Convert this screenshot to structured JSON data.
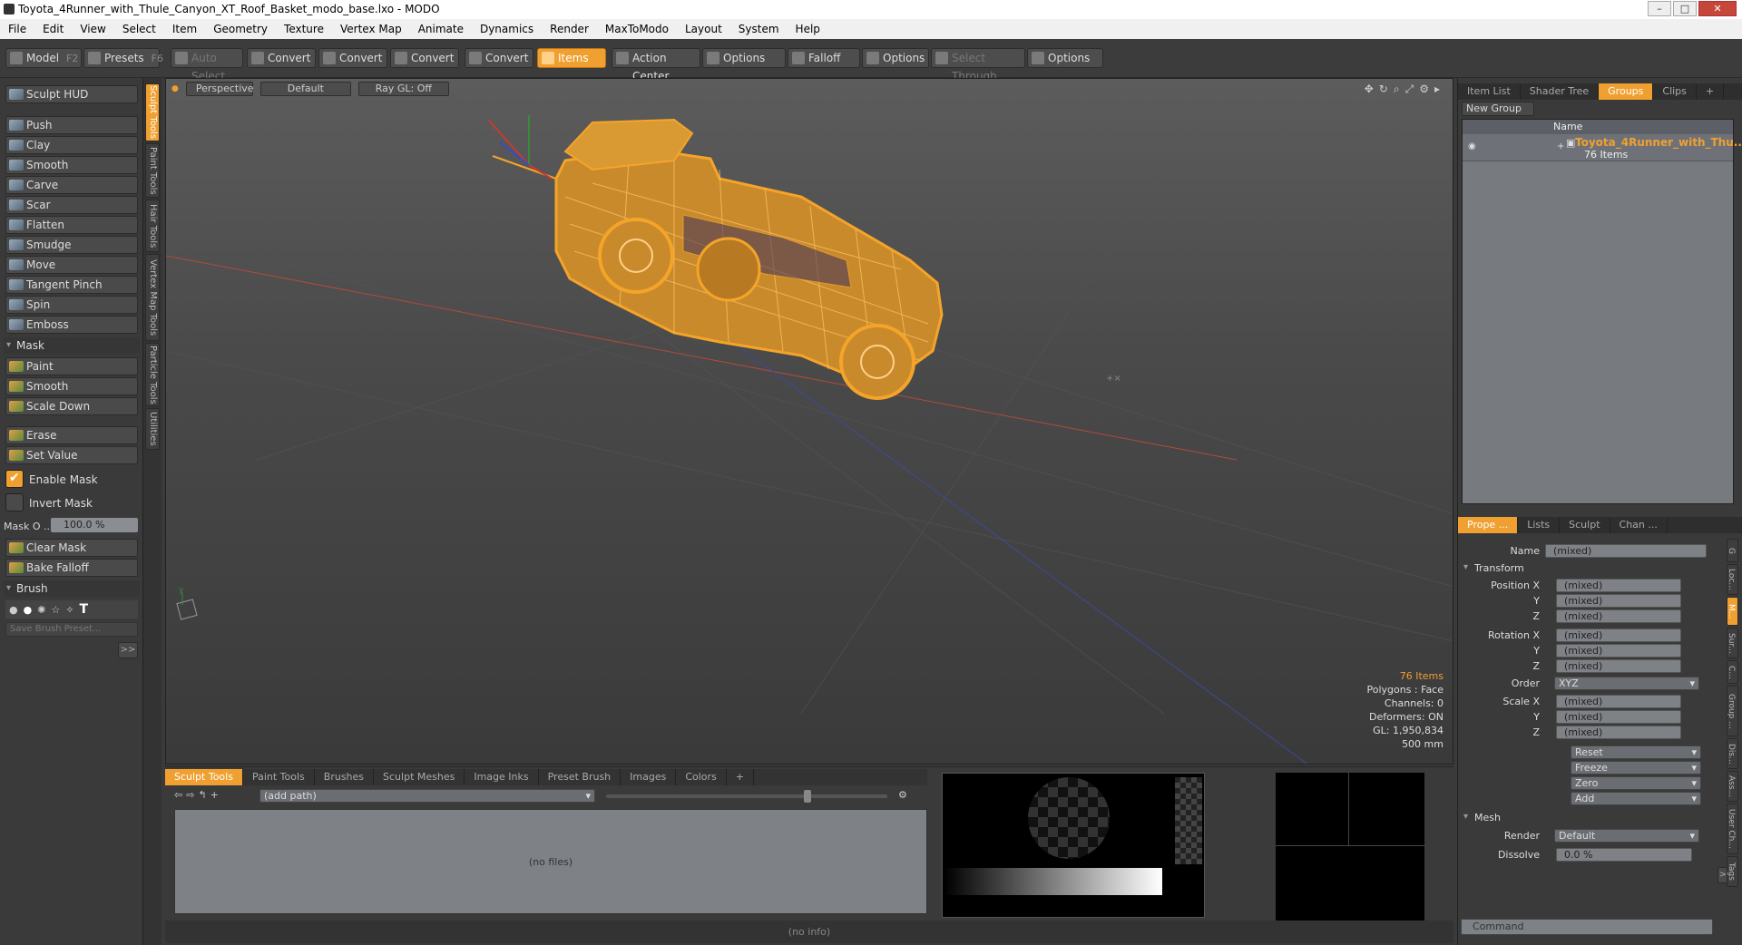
{
  "window": {
    "title": "Toyota_4Runner_with_Thule_Canyon_XT_Roof_Basket_modo_base.lxo - MODO",
    "min": "–",
    "max": "□",
    "close": "✕"
  },
  "menu": [
    "File",
    "Edit",
    "View",
    "Select",
    "Item",
    "Geometry",
    "Texture",
    "Vertex Map",
    "Animate",
    "Dynamics",
    "Render",
    "MaxToModo",
    "Layout",
    "System",
    "Help"
  ],
  "toolbar": {
    "model": "Model",
    "model_key": "F2",
    "presets": "Presets",
    "presets_key": "F6",
    "auto_select": "Auto Select",
    "convert1": "Convert",
    "convert2": "Convert",
    "convert3": "Convert",
    "convert4": "Convert",
    "items": "Items",
    "action_center": "Action Center",
    "options1": "Options",
    "falloff": "Falloff",
    "options2": "Options",
    "select_through": "Select Through",
    "options3": "Options"
  },
  "left": {
    "sculpt_hud": "Sculpt HUD",
    "tools": [
      "Push",
      "Clay",
      "Smooth",
      "Carve",
      "Scar",
      "Flatten",
      "Smudge",
      "Move",
      "Tangent Pinch",
      "Spin",
      "Emboss"
    ],
    "mask_header": "Mask",
    "mask_tools": [
      "Paint",
      "Smooth",
      "Scale Down"
    ],
    "erase": "Erase",
    "set_value": "Set Value",
    "enable_mask": "Enable Mask",
    "invert_mask": "Invert Mask",
    "mask_opacity_label": "Mask O ...",
    "mask_opacity_value": "100.0 %",
    "clear_mask": "Clear Mask",
    "bake_falloff": "Bake Falloff",
    "brush_header": "Brush",
    "save_brush": "Save Brush Preset...",
    "more": ">>"
  },
  "vtabs": [
    "Sculpt Tools",
    "Paint Tools",
    "Hair Tools",
    "Vertex Map Tools",
    "Particle Tools",
    "Utilities"
  ],
  "viewport": {
    "view": "Perspective",
    "shading": "Default",
    "raygl": "Ray GL: Off",
    "info": {
      "items": "76 Items",
      "polygons": "Polygons : Face",
      "channels": "Channels: 0",
      "deformers": "Deformers: ON",
      "gl": "GL: 1,950,834",
      "scale": "500 mm"
    }
  },
  "right": {
    "tabs": [
      "Item List",
      "Shader Tree",
      "Groups",
      "Clips"
    ],
    "new_group": "New Group",
    "col_name": "Name",
    "group_name": "Toyota_4Runner_with_Thu...",
    "group_count": "76 Items",
    "prop_tabs": [
      "Prope ...",
      "Lists",
      "Sculpt",
      "Chan ..."
    ],
    "name_label": "Name",
    "name_value": "(mixed)",
    "transform": "Transform",
    "position": [
      "Position X",
      "Y",
      "Z"
    ],
    "rotation": [
      "Rotation X",
      "Y",
      "Z"
    ],
    "order_label": "Order",
    "order_value": "XYZ",
    "scale": [
      "Scale X",
      "Y",
      "Z"
    ],
    "mixed": "(mixed)",
    "actions": [
      "Reset",
      "Freeze",
      "Zero",
      "Add"
    ],
    "mesh": "Mesh",
    "render_label": "Render",
    "render_value": "Default",
    "dissolve_label": "Dissolve",
    "dissolve_value": "0.0 %",
    "side_tabs": [
      "G",
      "Loc...",
      "M...",
      "Sur...",
      "C...",
      "Group ...",
      "Dis...",
      "Ass...",
      "User Ch...",
      "Tags"
    ],
    "command_placeholder": "Command"
  },
  "bottom": {
    "tabs": [
      "Sculpt Tools",
      "Paint Tools",
      "Brushes",
      "Sculpt Meshes",
      "Image Inks",
      "Preset Brush",
      "Images",
      "Colors"
    ],
    "path": "(add path)",
    "files": "(no files)",
    "status": "(no info)"
  },
  "colors": {
    "accent": "#f0a030",
    "wire": "#f5a42a"
  }
}
